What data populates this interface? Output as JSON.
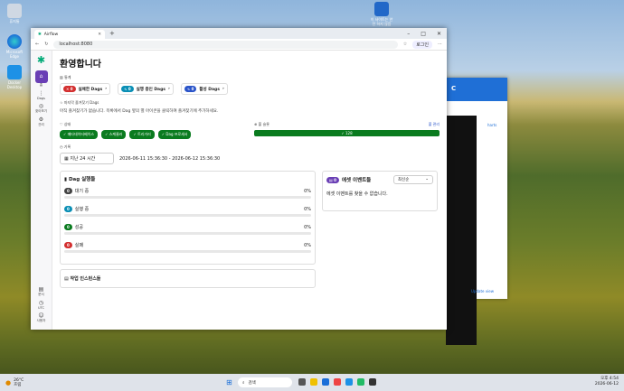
{
  "desktop": {
    "icons": [
      {
        "label": "휴지통"
      },
      {
        "label": "Microsoft Edge"
      },
      {
        "label": "Docker Desktop"
      },
      {
        "label": "이 사이트는 안전 하지 않음"
      }
    ]
  },
  "browser": {
    "tab_title": "Airflow",
    "url": "localhost:8080",
    "login": "로그인"
  },
  "nav": {
    "items": [
      {
        "label": "홈"
      },
      {
        "label": "Dags"
      },
      {
        "label": "찾아보기"
      },
      {
        "label": "관리"
      },
      {
        "label": "문서"
      },
      {
        "label": "UTC"
      },
      {
        "label": "사용자"
      }
    ]
  },
  "page": {
    "title": "환영합니다",
    "stats_header": "통계",
    "stats": [
      {
        "count": "0",
        "label": "실패한 Dags"
      },
      {
        "count": "0",
        "label": "실행 중인 Dags"
      },
      {
        "count": "0",
        "label": "활성 Dags"
      }
    ],
    "favorites_header": "마지막 즐겨찾기 Dags",
    "favorites_empty": "아직 즐겨찾기가 없습니다. 목록에서 Dag 옆의 별 아이콘을 클릭하여 즐겨찾기에 추가하세요.",
    "health_header": "상태",
    "health_chips": [
      "메타데이터베이스",
      "스케줄러",
      "트리거러",
      "Dag 프로세서"
    ],
    "pool_header": "풀 슬롯",
    "pool_link": "풀 관리",
    "pool_value": "128",
    "history_header": "기록",
    "range_select": "지난 24 시간",
    "range_text": "2026-06-11 15:36:30 - 2026-06-12 15:36:30",
    "dag_runs_title": "Dag 실행들",
    "dag_runs": [
      {
        "count": "0",
        "label": "대기 중",
        "pct": "0%",
        "color": "#444444"
      },
      {
        "count": "0",
        "label": "실행 중",
        "pct": "0%",
        "color": "#0b8fb5"
      },
      {
        "count": "0",
        "label": "성공",
        "pct": "0%",
        "color": "#0a7b1f"
      },
      {
        "count": "0",
        "label": "실패",
        "pct": "0%",
        "color": "#d32f2f"
      }
    ],
    "events_count": "0",
    "events_title": "에셋 이벤트들",
    "events_sort": "최신순",
    "events_empty": "에셋 이벤트를 찾을 수 없습니다.",
    "task_instances_title": "작업 인스턴스들"
  },
  "back_window": {
    "title": "C",
    "link": "harts",
    "update": "Update view"
  },
  "taskbar": {
    "weather_temp": "26°C",
    "weather_desc": "흐림",
    "search": "검색",
    "time": "오후 4:54",
    "date": "2026-06-12"
  }
}
